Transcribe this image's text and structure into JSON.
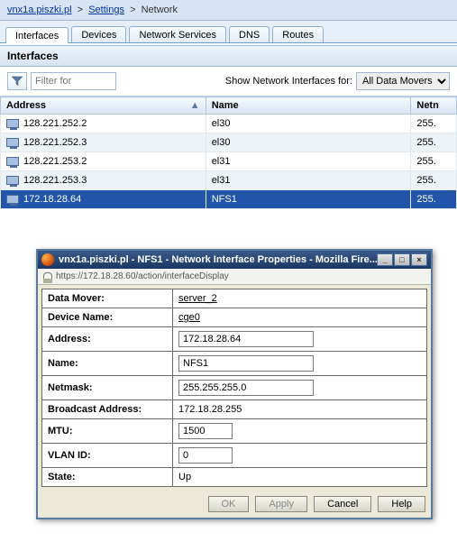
{
  "breadcrumb": {
    "host": "vnx1a.piszki.pl",
    "settings": "Settings",
    "current": "Network"
  },
  "tabs": [
    "Interfaces",
    "Devices",
    "Network Services",
    "DNS",
    "Routes"
  ],
  "active_tab": 0,
  "section_title": "Interfaces",
  "filter_placeholder": "Filter for",
  "filter_label": "Show Network Interfaces for:",
  "filter_value": "All Data Movers",
  "columns": {
    "address": "Address",
    "name": "Name",
    "netm": "Netn"
  },
  "rows": [
    {
      "address": "128.221.252.2",
      "name": "el30",
      "netm": "255.",
      "selected": false
    },
    {
      "address": "128.221.252.3",
      "name": "el30",
      "netm": "255.",
      "selected": false
    },
    {
      "address": "128.221.253.2",
      "name": "el31",
      "netm": "255.",
      "selected": false
    },
    {
      "address": "128.221.253.3",
      "name": "el31",
      "netm": "255.",
      "selected": false
    },
    {
      "address": "172.18.28.64",
      "name": "NFS1",
      "netm": "255.",
      "selected": true
    }
  ],
  "modal": {
    "title": "vnx1a.piszki.pl - NFS1 - Network Interface Properties - Mozilla Fire...",
    "url": "https://172.18.28.60/action/interfaceDisplay",
    "fields": {
      "data_mover_label": "Data Mover:",
      "data_mover_value": "server_2",
      "device_name_label": "Device Name:",
      "device_name_value": "cge0",
      "address_label": "Address:",
      "address_value": "172.18.28.64",
      "name_label": "Name:",
      "name_value": "NFS1",
      "netmask_label": "Netmask:",
      "netmask_value": "255.255.255.0",
      "broadcast_label": "Broadcast Address:",
      "broadcast_value": "172.18.28.255",
      "mtu_label": "MTU:",
      "mtu_value": "1500",
      "vlan_label": "VLAN ID:",
      "vlan_value": "0",
      "state_label": "State:",
      "state_value": "Up"
    },
    "buttons": {
      "ok": "OK",
      "apply": "Apply",
      "cancel": "Cancel",
      "help": "Help"
    }
  }
}
